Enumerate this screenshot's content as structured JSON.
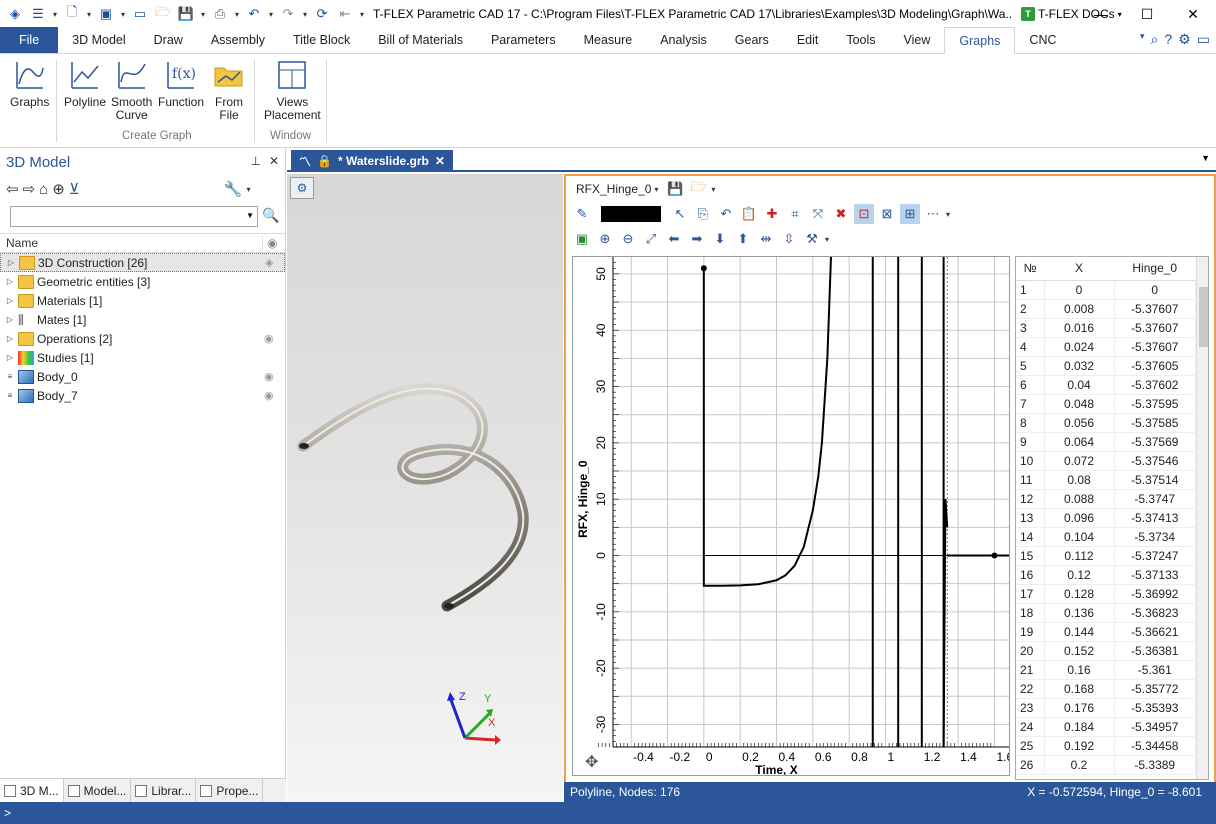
{
  "window": {
    "title": "T-FLEX Parametric CAD 17 - C:\\Program Files\\T-FLEX Parametric CAD 17\\Libraries\\Examples\\3D Modeling\\Graph\\Wa...",
    "docs_label": "T-FLEX DOCs",
    "docs_logo": "T",
    "minimize": "—",
    "maximize": "☐",
    "close": "✕"
  },
  "ribbon_tabs": [
    "File",
    "3D Model",
    "Draw",
    "Assembly",
    "Title Block",
    "Bill of Materials",
    "Parameters",
    "Measure",
    "Analysis",
    "Gears",
    "Edit",
    "Tools",
    "View",
    "Graphs",
    "CNC"
  ],
  "active_tab": "Graphs",
  "ribbon": {
    "graphs_label": "Graphs",
    "polyline_label": "Polyline",
    "smooth_label1": "Smooth",
    "smooth_label2": "Curve",
    "function_label": "Function",
    "fromfile_label1": "From",
    "fromfile_label2": "File",
    "views_label1": "Views",
    "views_label2": "Placement",
    "group_create": "Create Graph",
    "group_window": "Window"
  },
  "left_panel": {
    "title": "3D Model",
    "pin": "📌",
    "close": "✕",
    "column_name": "Name",
    "tree": [
      {
        "label": "3D Construction [26]",
        "icon": "folder",
        "expand": "▷",
        "visible": true,
        "selected": true
      },
      {
        "label": "Geometric entities [3]",
        "icon": "folder",
        "expand": "▷",
        "visible": false
      },
      {
        "label": "Materials [1]",
        "icon": "folder",
        "expand": "▷",
        "visible": false
      },
      {
        "label": "Mates [1]",
        "icon": "mates",
        "expand": "▷",
        "visible": false
      },
      {
        "label": "Operations [2]",
        "icon": "folder",
        "expand": "▷",
        "visible": true
      },
      {
        "label": "Studies [1]",
        "icon": "study",
        "expand": "▷",
        "visible": false
      },
      {
        "label": "Body_0",
        "icon": "cube",
        "expand": "≡",
        "visible": true
      },
      {
        "label": "Body_7",
        "icon": "cube",
        "expand": "≡",
        "visible": true
      }
    ],
    "bottom_tabs": [
      "3D M...",
      "Model...",
      "Librar...",
      "Prope..."
    ]
  },
  "document_tab": {
    "title": "* Waterslide.grb",
    "close": "✕"
  },
  "graph": {
    "name": "RFX_Hinge_0",
    "ylabel": "RFX, Hinge_0",
    "xlabel": "Time, X",
    "move_icon": "✥",
    "status_left": "Polyline, Nodes: 176",
    "status_right": "X = -0.572594, Hinge_0 = -8.601"
  },
  "chart_data": {
    "type": "line",
    "xlabel": "Time, X",
    "ylabel": "RFX, Hinge_0",
    "xlim": [
      -0.5,
      1.68
    ],
    "ylim": [
      -34,
      53
    ],
    "x_ticks": [
      -0.4,
      -0.2,
      0,
      0.2,
      0.4,
      0.6,
      0.8,
      1,
      1.2,
      1.4,
      1.6
    ],
    "y_ticks": [
      -30,
      -20,
      -10,
      0,
      10,
      20,
      30,
      40,
      50
    ],
    "grid": true,
    "series": [
      {
        "x": [
          0,
          0,
          0,
          0.05,
          0.1,
          0.2,
          0.3,
          0.4,
          0.45,
          0.5,
          0.55,
          0.6,
          0.63,
          0.65,
          0.68,
          0.7
        ],
        "y": [
          51,
          0,
          -5.37,
          -5.37,
          -5.36,
          -5.3,
          -5.1,
          -4.4,
          -3.5,
          -1.8,
          1.5,
          8,
          14,
          20,
          35,
          53
        ]
      }
    ],
    "vertical_lines": [
      0.93,
      1.07,
      1.2,
      1.32
    ],
    "spike": {
      "x": [
        1.32,
        1.33,
        1.34
      ],
      "y": [
        -34,
        10,
        5
      ]
    },
    "tail": {
      "x": [
        1.34,
        1.6,
        1.68
      ],
      "y": [
        0,
        0,
        0
      ]
    }
  },
  "table": {
    "headers": [
      "№",
      "X",
      "Hinge_0"
    ],
    "rows": [
      [
        "1",
        "0",
        "0"
      ],
      [
        "2",
        "0.008",
        "-5.37607"
      ],
      [
        "3",
        "0.016",
        "-5.37607"
      ],
      [
        "4",
        "0.024",
        "-5.37607"
      ],
      [
        "5",
        "0.032",
        "-5.37605"
      ],
      [
        "6",
        "0.04",
        "-5.37602"
      ],
      [
        "7",
        "0.048",
        "-5.37595"
      ],
      [
        "8",
        "0.056",
        "-5.37585"
      ],
      [
        "9",
        "0.064",
        "-5.37569"
      ],
      [
        "10",
        "0.072",
        "-5.37546"
      ],
      [
        "11",
        "0.08",
        "-5.37514"
      ],
      [
        "12",
        "0.088",
        "-5.3747"
      ],
      [
        "13",
        "0.096",
        "-5.37413"
      ],
      [
        "14",
        "0.104",
        "-5.3734"
      ],
      [
        "15",
        "0.112",
        "-5.37247"
      ],
      [
        "16",
        "0.12",
        "-5.37133"
      ],
      [
        "17",
        "0.128",
        "-5.36992"
      ],
      [
        "18",
        "0.136",
        "-5.36823"
      ],
      [
        "19",
        "0.144",
        "-5.36621"
      ],
      [
        "20",
        "0.152",
        "-5.36381"
      ],
      [
        "21",
        "0.16",
        "-5.361"
      ],
      [
        "22",
        "0.168",
        "-5.35772"
      ],
      [
        "23",
        "0.176",
        "-5.35393"
      ],
      [
        "24",
        "0.184",
        "-5.34957"
      ],
      [
        "25",
        "0.192",
        "-5.34458"
      ],
      [
        "26",
        "0.2",
        "-5.3389"
      ]
    ]
  },
  "triad": {
    "x": "X",
    "y": "Y",
    "z": "Z"
  },
  "app_status": ">",
  "colors": {
    "accent": "#2b579a",
    "highlight": "#f0a04b"
  }
}
